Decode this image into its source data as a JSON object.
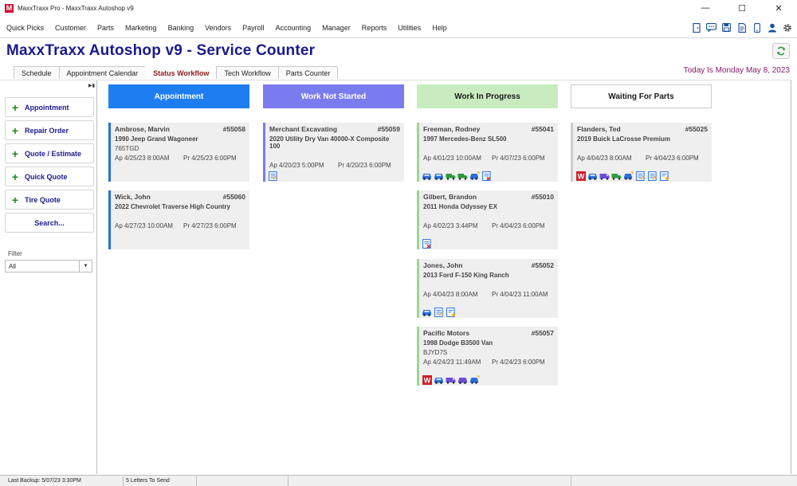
{
  "window": {
    "title": "MaxxTraxx Pro - MaxxTraxx Autoshop v9",
    "logo_letter": "M",
    "controls": [
      "—",
      "☐",
      "✕"
    ]
  },
  "menu": [
    "Quick Picks",
    "Customer",
    "Parts",
    "Marketing",
    "Banking",
    "Vendors",
    "Payroll",
    "Accounting",
    "Manager",
    "Reports",
    "Utilities",
    "Help"
  ],
  "toolbar_icons": [
    "door-icon",
    "chat-icon",
    "floppy-disk-icon",
    "document-icon",
    "phone-icon",
    "person-icon",
    "gear-icon"
  ],
  "heading": "MaxxTraxx Autoshop v9 - Service Counter",
  "today": "Today Is Monday May  8, 2023",
  "tabs": [
    {
      "label": "Schedule",
      "active": false
    },
    {
      "label": "Appointment Calendar",
      "active": false
    },
    {
      "label": "Status Workflow",
      "active": true
    },
    {
      "label": "Tech Workflow",
      "active": false
    },
    {
      "label": "Parts Counter",
      "active": false
    }
  ],
  "sidebar": {
    "buttons": [
      "Appointment",
      "Repair Order",
      "Quote / Estimate",
      "Quick Quote",
      "Tire Quote"
    ],
    "search_label": "Search...",
    "filter_label": "Filter",
    "filter_value": "All"
  },
  "columns": [
    {
      "title": "Appointment",
      "bg": "#1e7df0",
      "fg": "#ffffff",
      "accent": "#2a6fdb",
      "cards": [
        {
          "name": "Ambrose, Marvin",
          "number": "#55058",
          "vehicle": "1990 Jeep Grand Wagoneer",
          "plate": "765TGD",
          "ap": "Ap 4/25/23  8:00AM",
          "pr": "Pr 4/25/23  6:00PM",
          "icons": []
        },
        {
          "name": "Wick, John",
          "number": "#55060",
          "vehicle": "2022 Chevrolet Traverse High Country",
          "plate": "",
          "ap": "Ap 4/27/23 10:00AM",
          "pr": "Pr 4/27/23  6:00PM",
          "icons": []
        }
      ]
    },
    {
      "title": "Work Not Started",
      "bg": "#7b7bf0",
      "fg": "#ffffff",
      "accent": "#7b7bf0",
      "cards": [
        {
          "name": "Merchant Excavating",
          "number": "#55059",
          "vehicle": "2020 Utility Dry Van 40000-X Composite 100",
          "plate": "",
          "ap": "Ap 4/20/23  5:00PM",
          "pr": "Pr 4/20/23  6:00PM",
          "icons": [
            "note-icon"
          ]
        }
      ]
    },
    {
      "title": "Work In Progress",
      "bg": "#c8ecc0",
      "fg": "#1a1a1a",
      "accent": "#9ed68f",
      "cards": [
        {
          "name": "Freeman, Rodney",
          "number": "#55041",
          "vehicle": "1997 Mercedes-Benz SL500",
          "plate": "",
          "ap": "Ap 4/01/23 10:00AM",
          "pr": "Pr 4/07/23  6:00PM",
          "icons": [
            "car-blue-icon",
            "car-blue-icon",
            "truck-green-icon",
            "truck-green-icon",
            "wrench-car-icon",
            "note-red-icon"
          ]
        },
        {
          "name": "Gilbert, Brandon",
          "number": "#55010",
          "vehicle": "2011 Honda Odyssey EX",
          "plate": "",
          "ap": "Ap 4/02/23  3:44PM",
          "pr": "Pr 4/04/23  6:00PM",
          "icons": [
            "note-red-icon"
          ]
        },
        {
          "name": "Jones, John",
          "number": "#55052",
          "vehicle": "2013 Ford F-150 King Ranch",
          "plate": "",
          "ap": "Ap 4/04/23  8:00AM",
          "pr": "Pr 4/04/23 11:00AM",
          "icons": [
            "car-blue-icon",
            "note-icon",
            "star-note-icon"
          ]
        },
        {
          "name": "Pacific Motors",
          "number": "#55057",
          "vehicle": "1998 Dodge B3500 Van",
          "plate": "BJYD7S",
          "ap": "Ap 4/24/23 11:49AM",
          "pr": "Pr 4/24/23  6:00PM",
          "icons": [
            "w-badge-icon",
            "car-blue-icon",
            "van-purple-icon",
            "car-purple-icon",
            "wrench-car-icon"
          ]
        }
      ]
    },
    {
      "title": "Waiting For Parts",
      "bg": "#ffffff",
      "fg": "#1a1a1a",
      "accent": "#cccccc",
      "cards": [
        {
          "name": "Flanders, Ted",
          "number": "#55025",
          "vehicle": "2019 Buick LaCrosse Premium",
          "plate": "",
          "ap": "Ap 4/04/23  8:00AM",
          "pr": "Pr 4/04/23  6:00PM",
          "icons": [
            "w-badge-icon",
            "car-blue-icon",
            "van-purple-icon",
            "truck-green-icon",
            "wrench-car-icon",
            "note-icon",
            "note-icon",
            "star-note-icon"
          ]
        }
      ]
    }
  ],
  "status_bar": {
    "last_backup": "Last Backup: 5/07/23  3:30PM",
    "letters": "5 Letters To Send"
  }
}
